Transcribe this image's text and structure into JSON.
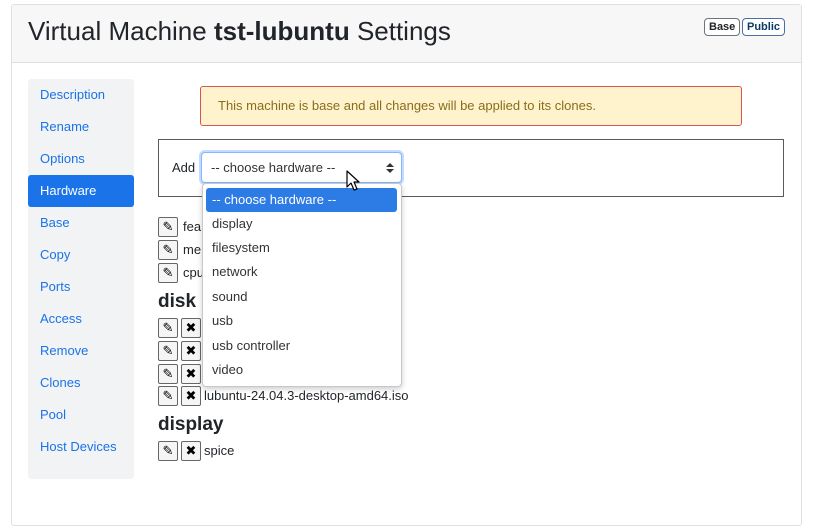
{
  "header": {
    "title_prefix": "Virtual Machine",
    "title_name": "tst-lubuntu",
    "title_suffix": "Settings",
    "badges": [
      "Base",
      "Public"
    ]
  },
  "sidebar": {
    "items": [
      {
        "label": "Description"
      },
      {
        "label": "Rename"
      },
      {
        "label": "Options"
      },
      {
        "label": "Hardware",
        "active": true
      },
      {
        "label": "Base"
      },
      {
        "label": "Copy"
      },
      {
        "label": "Ports"
      },
      {
        "label": "Access"
      },
      {
        "label": "Remove"
      },
      {
        "label": "Clones"
      },
      {
        "label": "Pool"
      },
      {
        "label": "Host Devices"
      }
    ]
  },
  "alert": {
    "text": "This machine is base and all changes will be applied to its clones."
  },
  "add_hardware": {
    "label": "Add",
    "selected": "-- choose hardware --",
    "options": [
      "-- choose hardware --",
      "display",
      "filesystem",
      "network",
      "sound",
      "usb",
      "usb controller",
      "video"
    ]
  },
  "hardware": {
    "top_items": [
      "fea",
      "me",
      "cpu"
    ],
    "disk_heading": "disk",
    "disk_items": [
      "lubuntu-24.04.3-desktop-amd64.iso"
    ],
    "display_heading": "display",
    "display_items": [
      "spice"
    ]
  },
  "icons": {
    "edit": "pencil-icon",
    "remove": "close-icon"
  },
  "colors": {
    "accent": "#1a73e8",
    "alert_bg": "#fff3cd",
    "alert_border": "#d9534f",
    "alert_text": "#8a6d1a"
  }
}
